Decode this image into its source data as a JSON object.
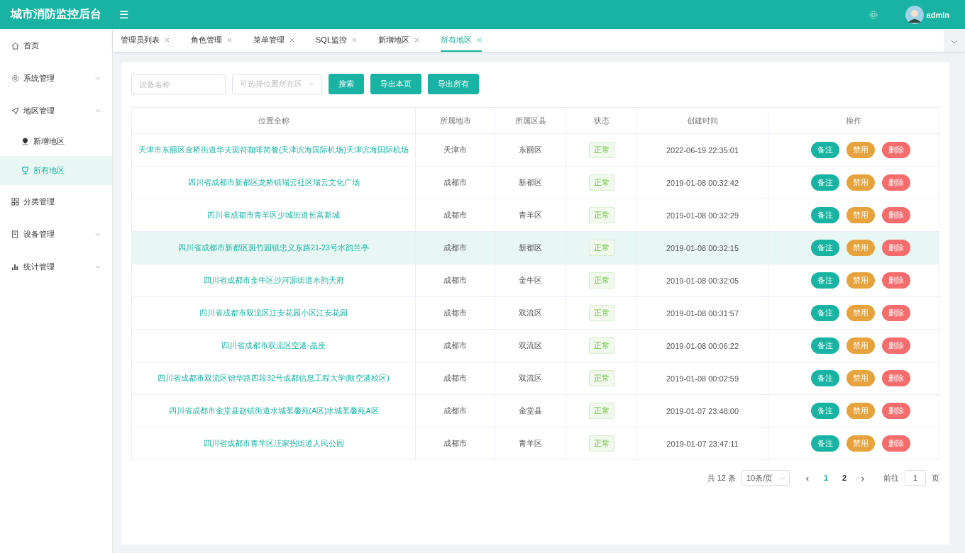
{
  "header": {
    "title": "城市消防监控后台",
    "menu_glyph": "☰",
    "user": "admin"
  },
  "sidebar": {
    "items": [
      {
        "label": "首页",
        "selected": false
      },
      {
        "label": "系统管理",
        "expanded": false,
        "selected": false
      },
      {
        "label": "地区管理",
        "expanded": true,
        "selected": false,
        "children": [
          {
            "label": "新增地区",
            "selected": false
          },
          {
            "label": "所有地区",
            "selected": true
          }
        ]
      },
      {
        "label": "分类管理",
        "selected": false
      },
      {
        "label": "设备管理",
        "expanded": false,
        "selected": false
      },
      {
        "label": "统计管理",
        "expanded": false,
        "selected": false
      }
    ]
  },
  "tabs": [
    {
      "label": "管理员列表",
      "selected": false
    },
    {
      "label": "角色管理",
      "selected": false
    },
    {
      "label": "菜单管理",
      "selected": false
    },
    {
      "label": "SQL监控",
      "selected": false
    },
    {
      "label": "新增地区",
      "selected": false
    },
    {
      "label": "所有地区",
      "selected": true
    }
  ],
  "filters": {
    "name_placeholder": "设备名称",
    "area_placeholder": "可选择位置所在区",
    "buttons": [
      "搜索",
      "导出本页",
      "导出所有"
    ]
  },
  "table": {
    "columns": [
      "位置全称",
      "所属地市",
      "所属区县",
      "状态",
      "创建时间",
      "操作"
    ],
    "rows": [
      {
        "name": "天津市东丽区金桥街道华夫斑符咖啡简餐(天津滨海国际机场)天津滨海国际机场",
        "city": "天津市",
        "district": "东丽区",
        "status": "正常",
        "created": "2022-06-19 22:35:01",
        "actions": [
          "备注",
          "禁用",
          "删除"
        ],
        "selected": false
      },
      {
        "name": "四川省成都市新都区龙桥镇瑞云社区瑞云文化广场",
        "city": "成都市",
        "district": "新都区",
        "status": "正常",
        "created": "2019-01-08 00:32:42",
        "actions": [
          "备注",
          "禁用",
          "删除"
        ],
        "selected": false
      },
      {
        "name": "四川省成都市青羊区少城街道长富新城",
        "city": "成都市",
        "district": "青羊区",
        "status": "正常",
        "created": "2019-01-08 00:32:29",
        "actions": [
          "备注",
          "禁用",
          "删除"
        ],
        "selected": false
      },
      {
        "name": "四川省成都市新都区斑竹园镇忠义东路21-23号水韵兰亭",
        "city": "成都市",
        "district": "新都区",
        "status": "正常",
        "created": "2019-01-08 00:32:15",
        "actions": [
          "备注",
          "禁用",
          "删除"
        ],
        "selected": true
      },
      {
        "name": "四川省成都市金牛区沙河源街道水韵天府",
        "city": "成都市",
        "district": "金牛区",
        "status": "正常",
        "created": "2019-01-08 00:32:05",
        "actions": [
          "备注",
          "禁用",
          "删除"
        ],
        "selected": false
      },
      {
        "name": "四川省成都市双流区江安花园小区江安花园",
        "city": "成都市",
        "district": "双流区",
        "status": "正常",
        "created": "2019-01-08 00:31:57",
        "actions": [
          "备注",
          "禁用",
          "删除"
        ],
        "selected": false
      },
      {
        "name": "四川省成都市双流区空港·晶座",
        "city": "成都市",
        "district": "双流区",
        "status": "正常",
        "created": "2019-01-08 00:06:22",
        "actions": [
          "备注",
          "禁用",
          "删除"
        ],
        "selected": false
      },
      {
        "name": "四川省成都市双流区锦华路四段32号成都信息工程大学(航空港校区)",
        "city": "成都市",
        "district": "双流区",
        "status": "正常",
        "created": "2019-01-08 00:02:59",
        "actions": [
          "备注",
          "禁用",
          "删除"
        ],
        "selected": false
      },
      {
        "name": "四川省成都市金堂县赵镇街道水城茗馨苑(A区)水城茗馨苑A区",
        "city": "成都市",
        "district": "金堂县",
        "status": "正常",
        "created": "2019-01-07 23:48:00",
        "actions": [
          "备注",
          "禁用",
          "删除"
        ],
        "selected": false
      },
      {
        "name": "四川省成都市青羊区汪家拐街道人民公园",
        "city": "成都市",
        "district": "青羊区",
        "status": "正常",
        "created": "2019-01-07 23:47:11",
        "actions": [
          "备注",
          "禁用",
          "删除"
        ],
        "selected": false
      }
    ]
  },
  "pagination": {
    "total": "共 12 条",
    "page_size": "10条/页",
    "prev": "‹",
    "next": "›",
    "pages": [
      {
        "label": "1",
        "selected": true
      },
      {
        "label": "2",
        "selected": false
      }
    ],
    "goto_label": "前往",
    "goto_value": "1",
    "goto_suffix": "页"
  }
}
